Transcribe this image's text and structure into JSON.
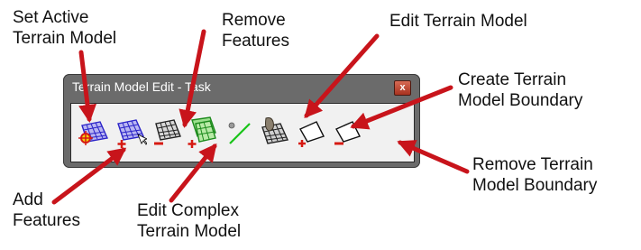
{
  "palette": {
    "title": "Terrain Model Edit - Task",
    "close_label": "x"
  },
  "tools": [
    {
      "name": "set-active-terrain-model-button",
      "icon": "set-active-terrain-icon"
    },
    {
      "name": "add-features-button",
      "icon": "add-features-icon"
    },
    {
      "name": "remove-features-button",
      "icon": "remove-features-icon"
    },
    {
      "name": "edit-complex-terrain-model-button",
      "icon": "edit-complex-terrain-icon"
    },
    {
      "name": "separator-tool-button",
      "icon": "line-separator-icon"
    },
    {
      "name": "edit-terrain-model-button",
      "icon": "edit-terrain-icon"
    },
    {
      "name": "create-terrain-model-boundary-button",
      "icon": "create-boundary-icon"
    },
    {
      "name": "remove-terrain-model-boundary-button",
      "icon": "remove-boundary-icon"
    }
  ],
  "callouts": {
    "set_active": [
      "Set Active",
      "Terrain Model"
    ],
    "remove_features": [
      "Remove",
      "Features"
    ],
    "edit_terrain": [
      "Edit Terrain Model"
    ],
    "create_boundary": [
      "Create Terrain",
      "Model Boundary"
    ],
    "remove_boundary": [
      "Remove Terrain",
      "Model Boundary"
    ],
    "add_features": [
      "Add",
      "Features"
    ],
    "edit_complex": [
      "Edit Complex",
      "Terrain Model"
    ]
  },
  "colors": {
    "arrow": "#c8141b",
    "palette_frame": "#6b6b6b",
    "toolbar_bg": "#f1f1f1"
  }
}
